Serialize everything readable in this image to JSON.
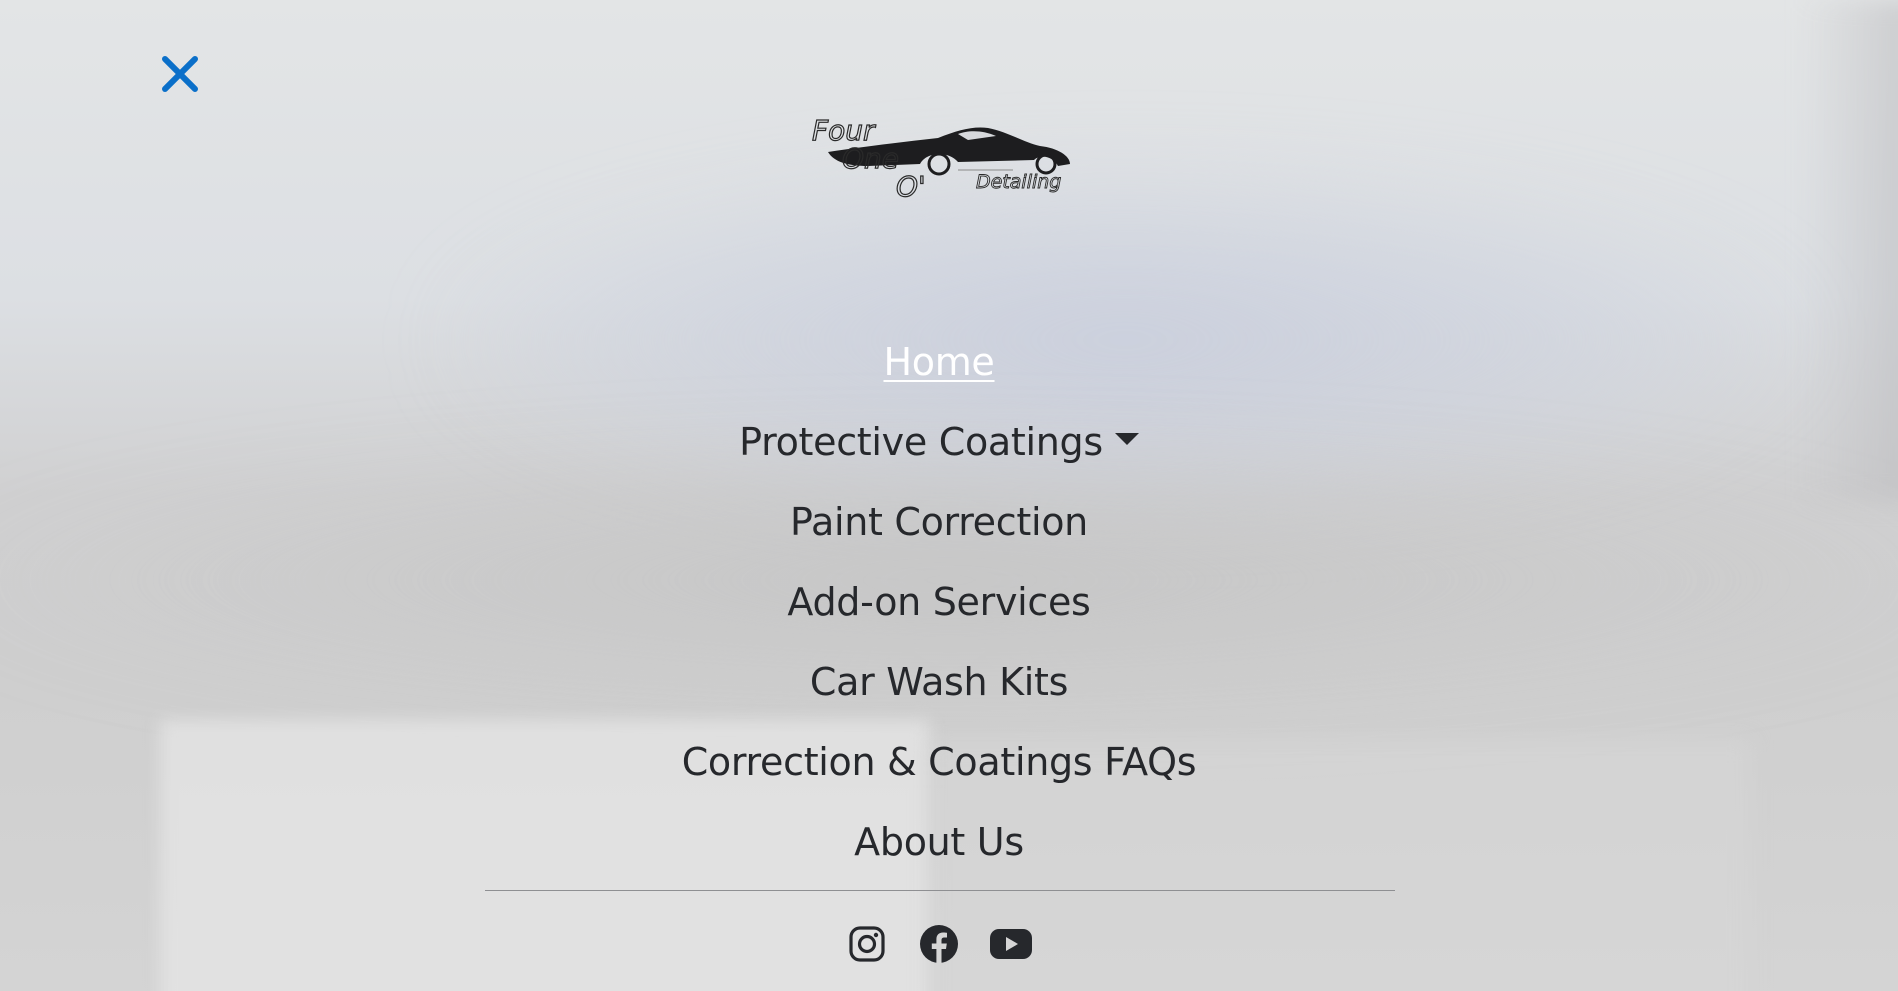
{
  "close": {
    "icon": "close-icon",
    "color": "#0a6fc9"
  },
  "logo": {
    "text_line1": "Four",
    "text_line2": "One",
    "text_line3": "O'",
    "text_tag": "Detailing"
  },
  "menu": {
    "items": [
      {
        "label": "Home",
        "active": true
      },
      {
        "label": "Protective Coatings",
        "has_dropdown": true
      },
      {
        "label": "Paint Correction"
      },
      {
        "label": "Add-on Services"
      },
      {
        "label": "Car Wash Kits"
      },
      {
        "label": "Correction & Coatings FAQs"
      },
      {
        "label": "About Us"
      }
    ]
  },
  "socials": [
    {
      "icon": "instagram-icon"
    },
    {
      "icon": "facebook-icon"
    },
    {
      "icon": "youtube-icon"
    }
  ],
  "colors": {
    "text": "#26282c",
    "active": "#ffffff",
    "accent": "#0a6fc9"
  }
}
